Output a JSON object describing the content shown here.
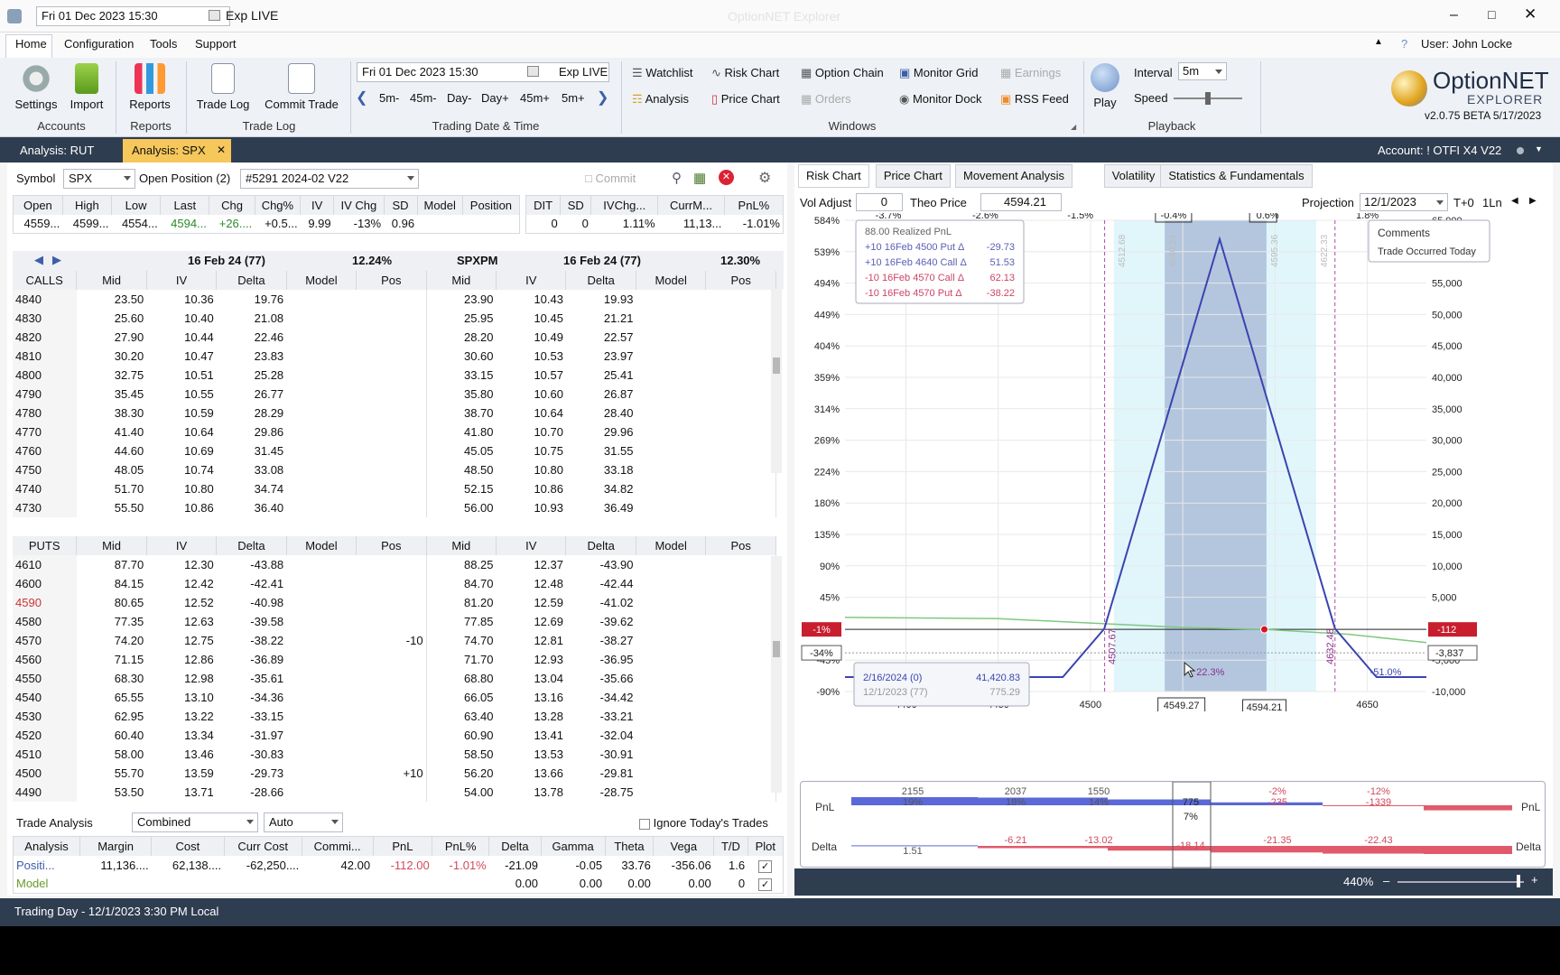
{
  "window": {
    "title": "OptionNET Explorer",
    "date_field": "Fri 01 Dec 2023 15:30",
    "exp_live": "Exp LIVE"
  },
  "menu": [
    "Home",
    "Configuration",
    "Tools",
    "Support"
  ],
  "user": "User: John Locke",
  "ribbon": {
    "settings": "Settings",
    "import": "Import",
    "reports": "Reports",
    "trade_log": "Trade Log",
    "commit_trade": "Commit Trade",
    "accounts_group": "Accounts",
    "reports_group": "Reports",
    "tradelog_group": "Trade Log",
    "trading_date_group": "Trading Date & Time",
    "windows_group": "Windows",
    "playback_group": "Playback",
    "date_field": "Fri 01 Dec 2023 15:30",
    "exp_live": "Exp LIVE",
    "steps": [
      "5m-",
      "45m-",
      "Day-",
      "Day+",
      "45m+",
      "5m+"
    ],
    "windows": [
      "Watchlist",
      "Risk Chart",
      "Option Chain",
      "Monitor Grid",
      "Earnings",
      "Analysis",
      "Price Chart",
      "Orders",
      "Monitor Dock",
      "RSS Feed"
    ],
    "play": "Play",
    "interval_label": "Interval",
    "interval_value": "5m",
    "speed_label": "Speed",
    "logo_text": "OptionNET",
    "logo_sub": "EXPLORER",
    "version": "v2.0.75 BETA 5/17/2023"
  },
  "doc_tabs": [
    "Analysis: RUT",
    "Analysis: SPX"
  ],
  "account": "Account: ! OTFI X4 V22",
  "symbol": {
    "label": "Symbol",
    "value": "SPX",
    "open_pos_label": "Open Position (2)",
    "open_pos_value": "#5291 2024-02 V22",
    "commit": "Commit"
  },
  "quote": {
    "headers": [
      "Open",
      "High",
      "Low",
      "Last",
      "Chg",
      "Chg%",
      "IV",
      "IV Chg",
      "SD",
      "Model",
      "Position"
    ],
    "values": [
      "4559...",
      "4599...",
      "4554...",
      "4594...",
      "+26....",
      "+0.5...",
      "9.99",
      "-13%",
      "0.96",
      "",
      ""
    ],
    "headers2": [
      "DIT",
      "SD",
      "IVChg...",
      "CurrM...",
      "PnL%"
    ],
    "values2": [
      "0",
      "0",
      "1.11%",
      "11,13...",
      "-1.01%"
    ]
  },
  "chain": {
    "left_exp": "16 Feb 24 (77)",
    "left_iv": "12.24%",
    "right_sym": "SPXPM",
    "right_exp": "16 Feb 24 (77)",
    "right_iv": "12.30%",
    "calls_label": "CALLS",
    "puts_label": "PUTS",
    "cols": [
      "Mid",
      "IV",
      "Delta",
      "Model",
      "Pos"
    ],
    "calls": [
      [
        "4840",
        "23.50",
        "10.36",
        "19.76",
        "",
        "",
        "23.90",
        "10.43",
        "19.93",
        "",
        ""
      ],
      [
        "4830",
        "25.60",
        "10.40",
        "21.08",
        "",
        "",
        "25.95",
        "10.45",
        "21.21",
        "",
        ""
      ],
      [
        "4820",
        "27.90",
        "10.44",
        "22.46",
        "",
        "",
        "28.20",
        "10.49",
        "22.57",
        "",
        ""
      ],
      [
        "4810",
        "30.20",
        "10.47",
        "23.83",
        "",
        "",
        "30.60",
        "10.53",
        "23.97",
        "",
        ""
      ],
      [
        "4800",
        "32.75",
        "10.51",
        "25.28",
        "",
        "",
        "33.15",
        "10.57",
        "25.41",
        "",
        ""
      ],
      [
        "4790",
        "35.45",
        "10.55",
        "26.77",
        "",
        "",
        "35.80",
        "10.60",
        "26.87",
        "",
        ""
      ],
      [
        "4780",
        "38.30",
        "10.59",
        "28.29",
        "",
        "",
        "38.70",
        "10.64",
        "28.40",
        "",
        ""
      ],
      [
        "4770",
        "41.40",
        "10.64",
        "29.86",
        "",
        "",
        "41.80",
        "10.70",
        "29.96",
        "",
        ""
      ],
      [
        "4760",
        "44.60",
        "10.69",
        "31.45",
        "",
        "",
        "45.05",
        "10.75",
        "31.55",
        "",
        ""
      ],
      [
        "4750",
        "48.05",
        "10.74",
        "33.08",
        "",
        "",
        "48.50",
        "10.80",
        "33.18",
        "",
        ""
      ],
      [
        "4740",
        "51.70",
        "10.80",
        "34.74",
        "",
        "",
        "52.15",
        "10.86",
        "34.82",
        "",
        ""
      ],
      [
        "4730",
        "55.50",
        "10.86",
        "36.40",
        "",
        "",
        "56.00",
        "10.93",
        "36.49",
        "",
        ""
      ]
    ],
    "puts": [
      [
        "4610",
        "87.70",
        "12.30",
        "-43.88",
        "",
        "",
        "88.25",
        "12.37",
        "-43.90",
        "",
        ""
      ],
      [
        "4600",
        "84.15",
        "12.42",
        "-42.41",
        "",
        "",
        "84.70",
        "12.48",
        "-42.44",
        "",
        ""
      ],
      [
        "4590",
        "80.65",
        "12.52",
        "-40.98",
        "",
        "",
        "81.20",
        "12.59",
        "-41.02",
        "",
        ""
      ],
      [
        "4580",
        "77.35",
        "12.63",
        "-39.58",
        "",
        "",
        "77.85",
        "12.69",
        "-39.62",
        "",
        ""
      ],
      [
        "4570",
        "74.20",
        "12.75",
        "-38.22",
        "",
        "-10",
        "74.70",
        "12.81",
        "-38.27",
        "",
        ""
      ],
      [
        "4560",
        "71.15",
        "12.86",
        "-36.89",
        "",
        "",
        "71.70",
        "12.93",
        "-36.95",
        "",
        ""
      ],
      [
        "4550",
        "68.30",
        "12.98",
        "-35.61",
        "",
        "",
        "68.80",
        "13.04",
        "-35.66",
        "",
        ""
      ],
      [
        "4540",
        "65.55",
        "13.10",
        "-34.36",
        "",
        "",
        "66.05",
        "13.16",
        "-34.42",
        "",
        ""
      ],
      [
        "4530",
        "62.95",
        "13.22",
        "-33.15",
        "",
        "",
        "63.40",
        "13.28",
        "-33.21",
        "",
        ""
      ],
      [
        "4520",
        "60.40",
        "13.34",
        "-31.97",
        "",
        "",
        "60.90",
        "13.41",
        "-32.04",
        "",
        ""
      ],
      [
        "4510",
        "58.00",
        "13.46",
        "-30.83",
        "",
        "",
        "58.50",
        "13.53",
        "-30.91",
        "",
        ""
      ],
      [
        "4500",
        "55.70",
        "13.59",
        "-29.73",
        "",
        "+10",
        "56.20",
        "13.66",
        "-29.81",
        "",
        ""
      ],
      [
        "4490",
        "53.50",
        "13.71",
        "-28.66",
        "",
        "",
        "54.00",
        "13.78",
        "-28.75",
        "",
        ""
      ]
    ]
  },
  "trade_analysis": {
    "label": "Trade Analysis",
    "mode": "Combined",
    "auto": "Auto",
    "ignore": "Ignore Today's Trades",
    "headers": [
      "Analysis",
      "Margin",
      "Cost",
      "Curr Cost",
      "Commi...",
      "PnL",
      "PnL%",
      "Delta",
      "Gamma",
      "Theta",
      "Vega",
      "T/D",
      "Plot"
    ],
    "rows": [
      [
        "Positi...",
        "11,136....",
        "62,138....",
        "-62,250....",
        "42.00",
        "-112.00",
        "-1.01%",
        "-21.09",
        "-0.05",
        "33.76",
        "-356.06",
        "1.6",
        ""
      ],
      [
        "Model",
        "",
        "",
        "",
        "",
        "",
        "",
        "0.00",
        "0.00",
        "0.00",
        "0.00",
        "0",
        ""
      ]
    ]
  },
  "right_tabs": [
    "Risk Chart",
    "Price Chart",
    "Movement Analysis",
    "Volatility",
    "Statistics & Fundamentals"
  ],
  "risk_controls": {
    "vol_adjust_label": "Vol Adjust",
    "vol_adjust": "0",
    "theo_label": "Theo Price",
    "theo": "4594.21",
    "proj_label": "Projection",
    "proj": "12/1/2023",
    "tplus": "T+0",
    "ln": "1Ln"
  },
  "chart_data": {
    "type": "line",
    "x_ticks": [
      4400,
      4450,
      4500,
      4550,
      4600,
      4650
    ],
    "x_tick_labels": [
      "4400",
      "4450",
      "4500",
      "",
      "",
      "4650"
    ],
    "top_pct_labels": [
      "-3.7%",
      "-2.6%",
      "-1.5%",
      "-0.4%",
      "0.6%",
      "1.8%"
    ],
    "top_pct_x": [
      4390.5,
      4443,
      4494.5,
      4545,
      4596,
      4650
    ],
    "left_axis": [
      "584%",
      "539%",
      "494%",
      "449%",
      "404%",
      "359%",
      "314%",
      "269%",
      "224%",
      "180%",
      "135%",
      "90%",
      "45%",
      "-45%",
      "-90%"
    ],
    "right_axis": [
      "65,000",
      "60,000",
      "55,000",
      "50,000",
      "45,000",
      "40,000",
      "35,000",
      "30,000",
      "25,000",
      "20,000",
      "15,000",
      "10,000",
      "5,000",
      "-5,000",
      "-10,000"
    ],
    "ylim": [
      -10000,
      65000
    ],
    "xlim": [
      4367,
      4682
    ],
    "expiry_line": {
      "name": "2/16/2024 (0)",
      "x": [
        4367,
        4485,
        4507.5,
        4570,
        4632.5,
        4655,
        4682
      ],
      "y": [
        -7700,
        -7700,
        0,
        62000,
        0,
        -7700,
        -7700
      ]
    },
    "t0_line": {
      "name": "12/1/2023 (77)",
      "x": [
        4367,
        4450,
        4500,
        4550,
        4594.21,
        4640,
        4682
      ],
      "y": [
        1800,
        1600,
        900,
        200,
        -112,
        -900,
        -2200
      ]
    },
    "current_pnl_label": "-112",
    "current_pct_label": "-1%",
    "low_pct_label": "-34%",
    "low_pnl_label": "-3,837",
    "price_marker": "4594.21",
    "cursor_price": "4549.27",
    "breakevens": [
      "4507.67",
      "4632.48"
    ],
    "shade_labels": [
      "4512.68",
      "4540.24",
      "4595.36",
      "4622.33"
    ],
    "center_pct": "22.3%",
    "right_pct": "-51.0%",
    "tooltip": {
      "date1": "2/16/2024 (0)",
      "val1": "41,420.83",
      "date2": "12/1/2023 (77)",
      "val2": "775.29"
    },
    "legend": [
      {
        "label": "88.00 Realized PnL",
        "color": "#666666"
      },
      {
        "label": "+10 16Feb 4500 Put Δ",
        "value": "-29.73",
        "color": "#5a5fb4"
      },
      {
        "label": "+10 16Feb 4640 Call Δ",
        "value": "51.53",
        "color": "#5a5fb4"
      },
      {
        "label": "-10 16Feb 4570 Call Δ",
        "value": "62.13",
        "color": "#cc4466"
      },
      {
        "label": "-10 16Feb 4570 Put Δ",
        "value": "-38.22",
        "color": "#cc4466"
      }
    ],
    "comments": {
      "title": "Comments",
      "text": "Trade Occurred Today"
    }
  },
  "bottom_pnl": {
    "label": "PnL",
    "values": [
      [
        "2155",
        "19%"
      ],
      [
        "2037",
        "18%"
      ],
      [
        "1550",
        "14%"
      ],
      [
        "775",
        "7%"
      ],
      [
        "-2%",
        "-235"
      ],
      [
        "-12%",
        "-1339"
      ]
    ],
    "delta_label": "Delta",
    "delta_values": [
      "1.51",
      "-6.21",
      "-13.02",
      "-18.14",
      "-21.35",
      "-22.43"
    ]
  },
  "zoom": "440%",
  "status": "Trading Day - 12/1/2023 3:30 PM Local",
  "colors": {
    "accent": "#2f3d50",
    "tab_active": "#f6c75a",
    "profit": "#5a5fb4",
    "loss": "#d14a5c"
  }
}
